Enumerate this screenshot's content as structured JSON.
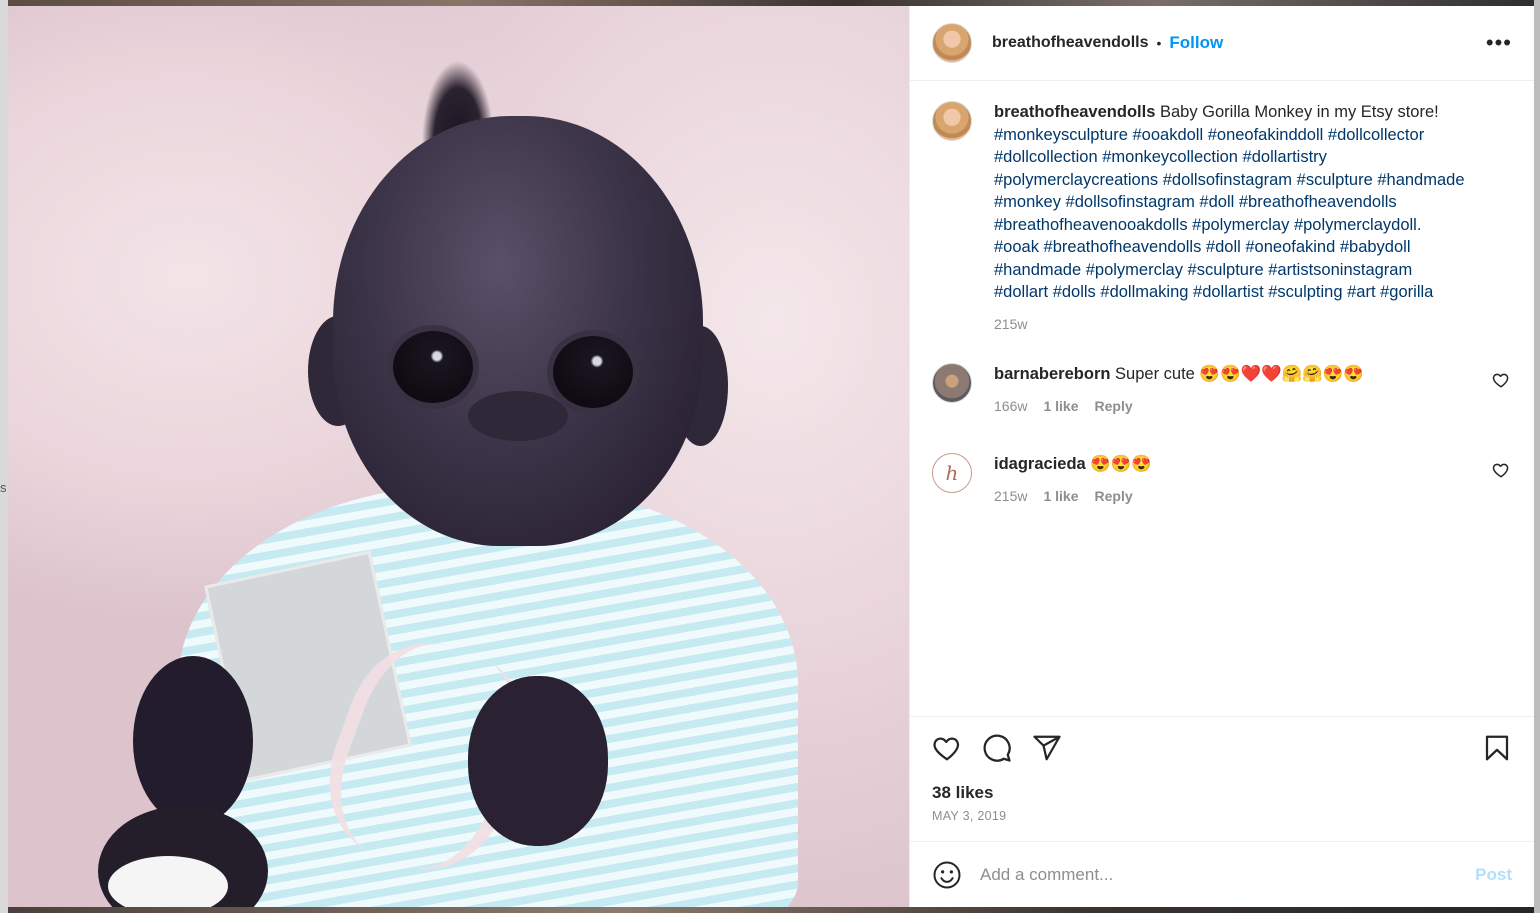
{
  "post": {
    "author": "breathofheavendolls",
    "follow_label": "Follow",
    "separator": "•",
    "more_label": "•••"
  },
  "caption": {
    "username": "breathofheavendolls",
    "text": "Baby Gorilla Monkey in my Etsy store!",
    "hashtag_lines": [
      "#monkeysculpture #ooakdoll #oneofakinddoll #dollcollector",
      "#dollcollection #monkeycollection #dollartistry",
      "#polymerclaycreations #dollsofinstagram #sculpture #handmade",
      "#monkey #dollsofinstagram #doll #breathofheavendolls",
      "#breathofheavenooakdolls #polymerclay #polymerclaydoll.",
      "#ooak #breathofheavendolls #doll #oneofakind #babydoll",
      "#handmade #polymerclay #sculpture #artistsoninstagram",
      "#dollart #dolls #dollmaking #dollartist #sculpting #art #gorilla"
    ],
    "age": "215w"
  },
  "comments": [
    {
      "username": "barnabereborn",
      "text": "Super cute 😍😍❤️❤️🤗🤗😍😍",
      "age": "166w",
      "likes": "1 like",
      "reply": "Reply"
    },
    {
      "username": "idagracieda",
      "avatar_glyph": "h",
      "text": "😍😍😍",
      "age": "215w",
      "likes": "1 like",
      "reply": "Reply"
    }
  ],
  "stats": {
    "likes": "38 likes",
    "date": "MAY 3, 2019"
  },
  "comment_box": {
    "placeholder": "Add a comment...",
    "post_label": "Post"
  },
  "side_letter": "s",
  "colors": {
    "link_blue": "#0095f6",
    "hashtag": "#00376b",
    "muted": "#8e8e8e",
    "post_disabled": "#b2dffc"
  }
}
